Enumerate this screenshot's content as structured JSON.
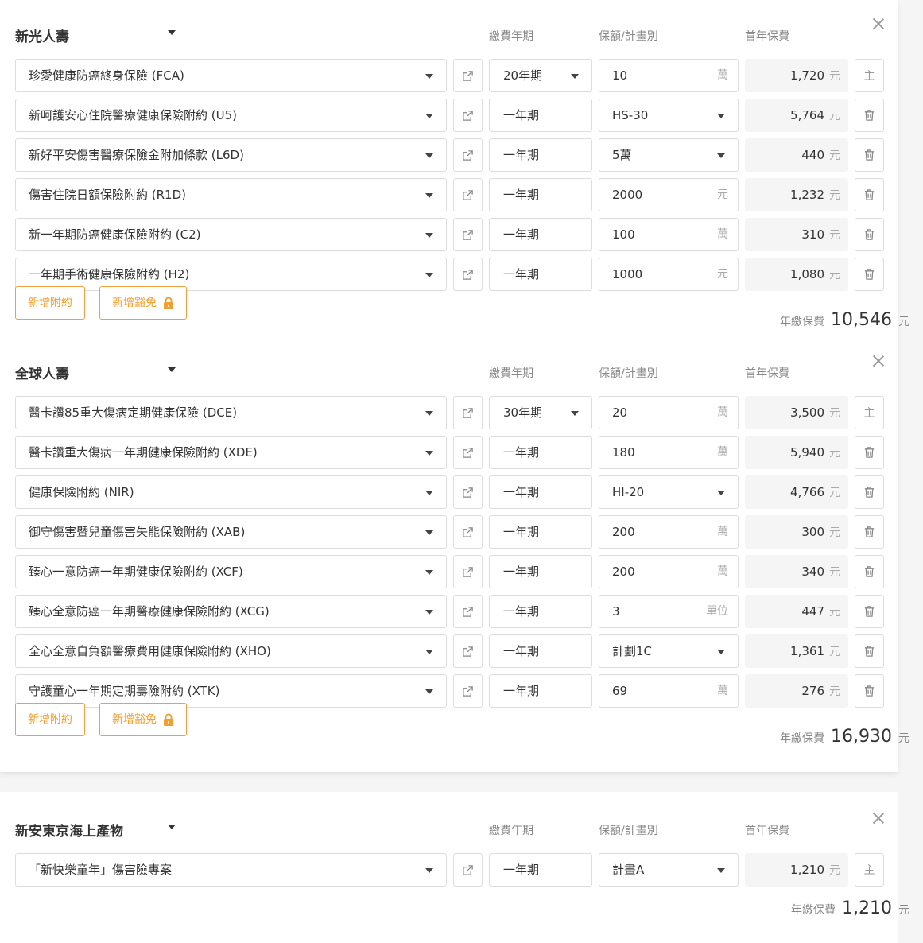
{
  "headers": {
    "term": "繳費年期",
    "amount": "保額/計畫別",
    "premium": "首年保費"
  },
  "labels": {
    "add_rider": "新增附約",
    "add_waiver": "新增豁免",
    "annual_total": "年繳保費",
    "unit_yuan": "元",
    "main_tag": "主"
  },
  "sections": [
    {
      "company": "新光人壽",
      "total": "10,546",
      "rows": [
        {
          "product": "珍愛健康防癌終身保險 (FCA)",
          "term": "20年期",
          "term_select": true,
          "amount": "10",
          "unit": "萬",
          "amount_select": false,
          "premium": "1,720",
          "main": true
        },
        {
          "product": "新呵護安心住院醫療健康保險附約 (U5)",
          "term": "一年期",
          "term_select": false,
          "amount": "HS-30",
          "unit": "",
          "amount_select": true,
          "premium": "5,764",
          "main": false
        },
        {
          "product": "新好平安傷害醫療保險金附加條款 (L6D)",
          "term": "一年期",
          "term_select": false,
          "amount": "5萬",
          "unit": "",
          "amount_select": true,
          "premium": "440",
          "main": false
        },
        {
          "product": "傷害住院日額保險附約 (R1D)",
          "term": "一年期",
          "term_select": false,
          "amount": "2000",
          "unit": "元",
          "amount_select": false,
          "premium": "1,232",
          "main": false
        },
        {
          "product": "新一年期防癌健康保險附約 (C2)",
          "term": "一年期",
          "term_select": false,
          "amount": "100",
          "unit": "萬",
          "amount_select": false,
          "premium": "310",
          "main": false
        },
        {
          "product": "一年期手術健康保險附約 (H2)",
          "term": "一年期",
          "term_select": false,
          "amount": "1000",
          "unit": "元",
          "amount_select": false,
          "premium": "1,080",
          "main": false
        }
      ]
    },
    {
      "company": "全球人壽",
      "total": "16,930",
      "rows": [
        {
          "product": "醫卡讚85重大傷病定期健康保險 (DCE)",
          "term": "30年期",
          "term_select": true,
          "amount": "20",
          "unit": "萬",
          "amount_select": false,
          "premium": "3,500",
          "main": true
        },
        {
          "product": "醫卡讚重大傷病一年期健康保險附約 (XDE)",
          "term": "一年期",
          "term_select": false,
          "amount": "180",
          "unit": "萬",
          "amount_select": false,
          "premium": "5,940",
          "main": false
        },
        {
          "product": "健康保險附約 (NIR)",
          "term": "一年期",
          "term_select": false,
          "amount": "HI-20",
          "unit": "",
          "amount_select": true,
          "premium": "4,766",
          "main": false
        },
        {
          "product": "御守傷害暨兒童傷害失能保險附約 (XAB)",
          "term": "一年期",
          "term_select": false,
          "amount": "200",
          "unit": "萬",
          "amount_select": false,
          "premium": "300",
          "main": false
        },
        {
          "product": "臻心一意防癌一年期健康保險附約 (XCF)",
          "term": "一年期",
          "term_select": false,
          "amount": "200",
          "unit": "萬",
          "amount_select": false,
          "premium": "340",
          "main": false
        },
        {
          "product": "臻心全意防癌一年期醫療健康保險附約 (XCG)",
          "term": "一年期",
          "term_select": false,
          "amount": "3",
          "unit": "單位",
          "amount_select": false,
          "premium": "447",
          "main": false
        },
        {
          "product": "全心全意自負額醫療費用健康保險附約 (XHO)",
          "term": "一年期",
          "term_select": false,
          "amount": "計劃1C",
          "unit": "",
          "amount_select": true,
          "premium": "1,361",
          "main": false
        },
        {
          "product": "守護童心一年期定期壽險附約 (XTK)",
          "term": "一年期",
          "term_select": false,
          "amount": "69",
          "unit": "萬",
          "amount_select": false,
          "premium": "276",
          "main": false
        }
      ]
    },
    {
      "company": "新安東京海上產物",
      "total": "1,210",
      "rows": [
        {
          "product": "「新快樂童年」傷害險專案",
          "term": "一年期",
          "term_select": false,
          "amount": "計畫A",
          "unit": "",
          "amount_select": true,
          "premium": "1,210",
          "main": true
        }
      ]
    }
  ]
}
